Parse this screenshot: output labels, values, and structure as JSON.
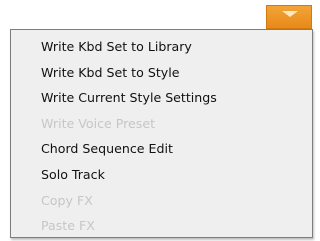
{
  "menu_button": {
    "icon": "chevron-down-icon",
    "color": "#ef9a2a"
  },
  "menu": {
    "items": [
      {
        "label": "Write Kbd Set to Library",
        "enabled": true
      },
      {
        "label": "Write Kbd Set to Style",
        "enabled": true
      },
      {
        "label": "Write Current Style Settings",
        "enabled": true
      },
      {
        "label": "Write Voice Preset",
        "enabled": false
      },
      {
        "label": "Chord Sequence Edit",
        "enabled": true
      },
      {
        "label": "Solo Track",
        "enabled": true
      },
      {
        "label": "Copy FX",
        "enabled": false
      },
      {
        "label": "Paste FX",
        "enabled": false
      }
    ]
  }
}
